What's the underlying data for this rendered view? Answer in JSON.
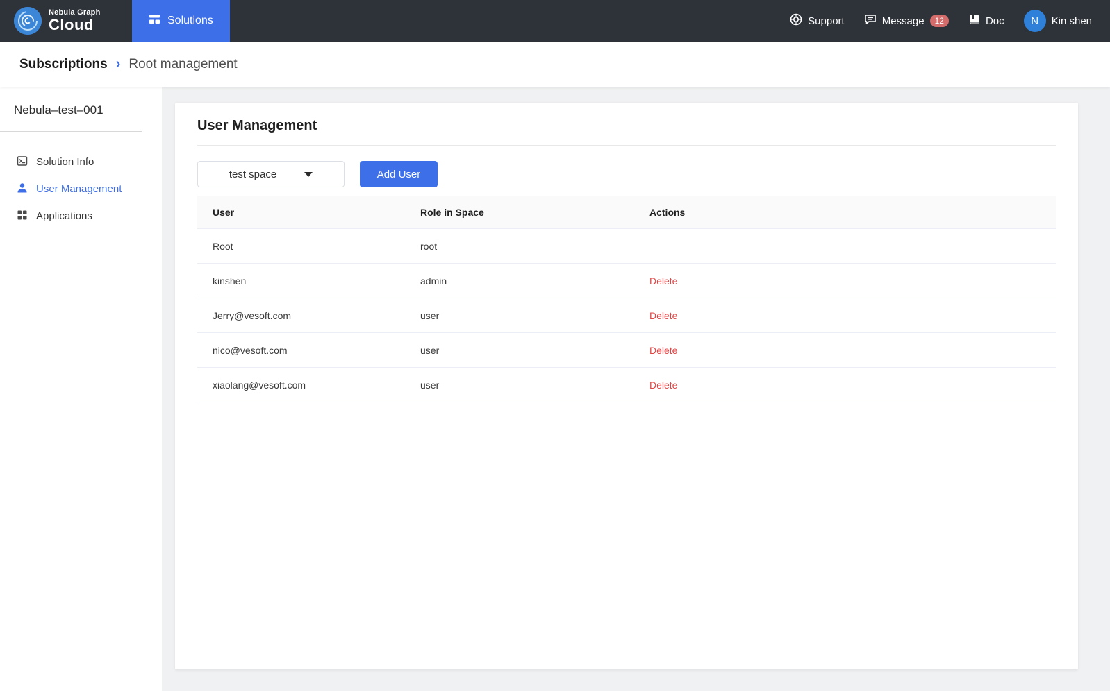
{
  "navbar": {
    "logo_top": "Nebula Graph",
    "logo_bottom": "Cloud",
    "solutions_label": "Solutions",
    "support_label": "Support",
    "message_label": "Message",
    "message_badge": "12",
    "doc_label": "Doc",
    "avatar_initial": "N",
    "username": "Kin shen"
  },
  "breadcrumb": {
    "root": "Subscriptions",
    "separator": "›",
    "current": "Root management"
  },
  "sidebar": {
    "title": "Nebula–test–001",
    "items": [
      {
        "label": "Solution Info"
      },
      {
        "label": "User Management"
      },
      {
        "label": "Applications"
      }
    ]
  },
  "main": {
    "title": "User Management",
    "space_select": "test space",
    "add_user_label": "Add User",
    "table": {
      "headers": [
        "User",
        "Role in Space",
        "Actions"
      ],
      "rows": [
        {
          "user": "Root",
          "role": "root",
          "action": ""
        },
        {
          "user": "kinshen",
          "role": "admin",
          "action": "Delete"
        },
        {
          "user": "Jerry@vesoft.com",
          "role": "user",
          "action": "Delete"
        },
        {
          "user": "nico@vesoft.com",
          "role": "user",
          "action": "Delete"
        },
        {
          "user": "xiaolang@vesoft.com",
          "role": "user",
          "action": "Delete"
        }
      ]
    }
  },
  "colors": {
    "navbar_dark": "#2e333a",
    "accent_blue": "#3d6fe8",
    "logo_blue": "#3c86d8",
    "delete_red": "#e04444",
    "badge_red": "#d56c6c",
    "main_bg": "#f0f1f2"
  }
}
